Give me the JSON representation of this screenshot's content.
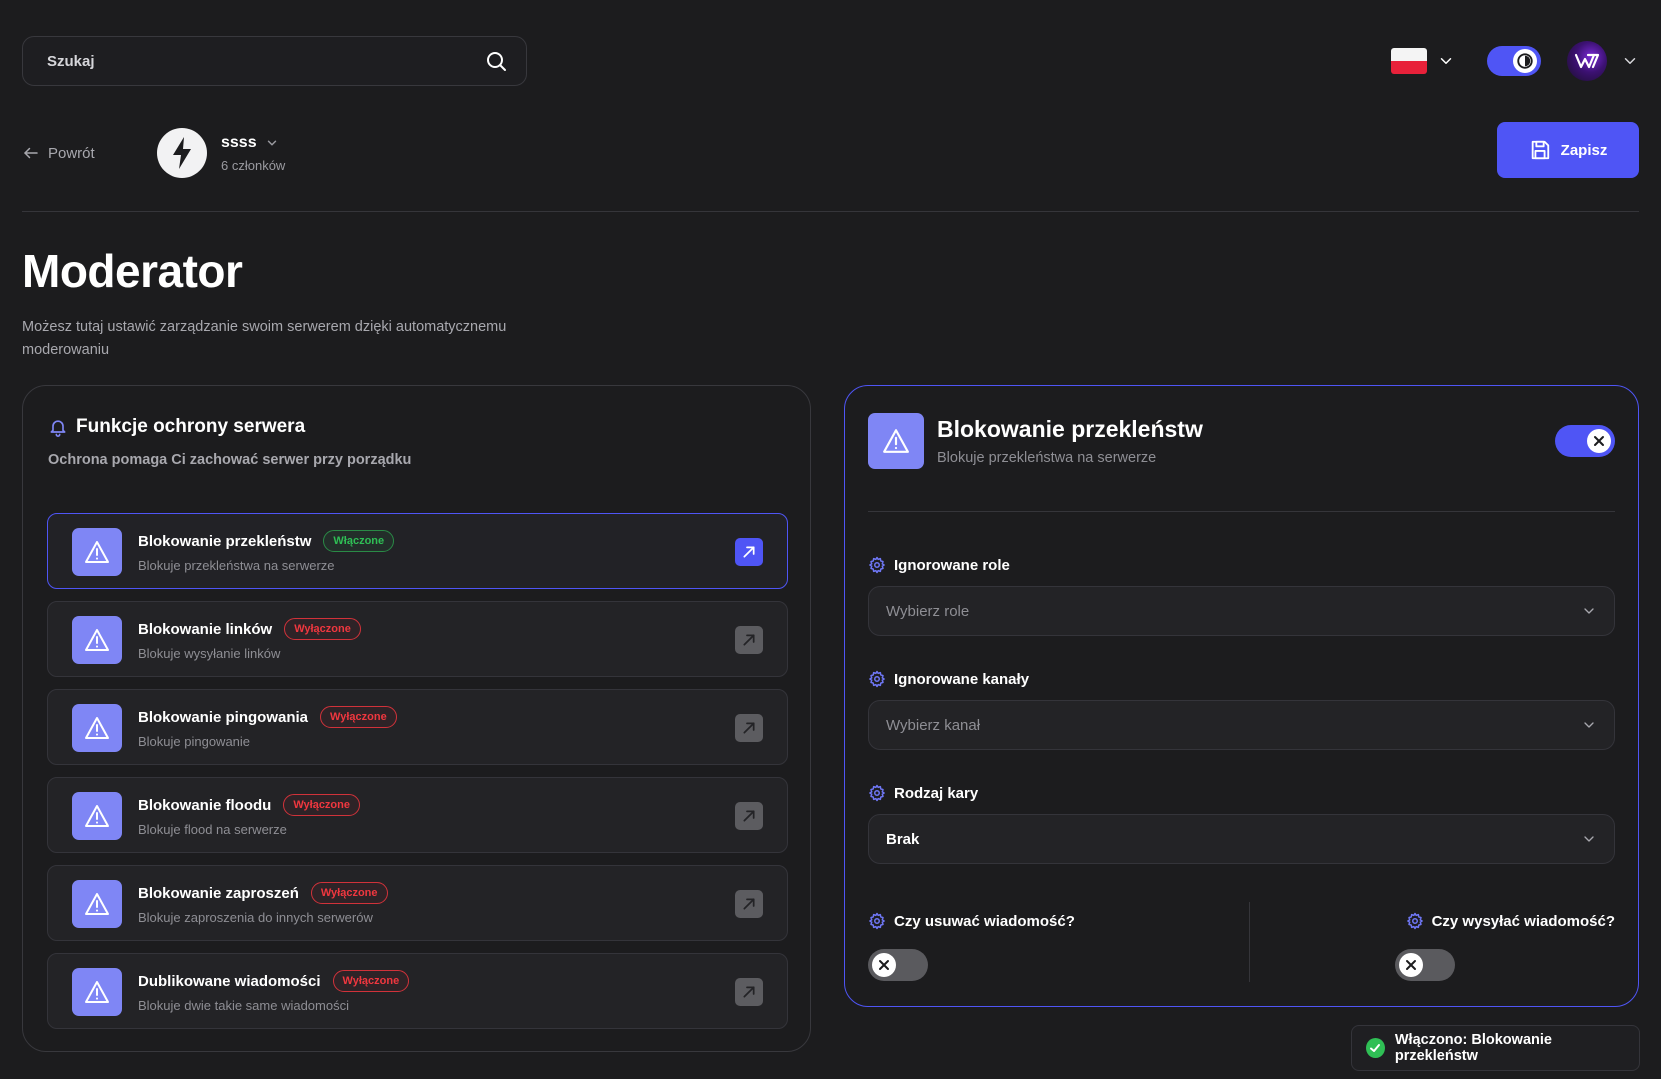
{
  "search": {
    "placeholder": "Szukaj"
  },
  "header": {
    "back_label": "Powrót",
    "server_name": "ssss",
    "server_members": "6 członków",
    "save_label": "Zapisz"
  },
  "page": {
    "title": "Moderator",
    "description": "Możesz tutaj ustawić zarządzanie swoim serwerem dzięki automatycznemu moderowaniu"
  },
  "protection": {
    "title": "Funkcje ochrony serwera",
    "subtitle": "Ochrona pomaga Ci zachować serwer przy porządku",
    "features": [
      {
        "name": "Blokowanie przekleństw",
        "status": "Włączone",
        "enabled": true,
        "desc": "Blokuje przekleństwa na serwerze"
      },
      {
        "name": "Blokowanie linków",
        "status": "Wyłączone",
        "enabled": false,
        "desc": "Blokuje wysyłanie linków"
      },
      {
        "name": "Blokowanie pingowania",
        "status": "Wyłączone",
        "enabled": false,
        "desc": "Blokuje pingowanie"
      },
      {
        "name": "Blokowanie floodu",
        "status": "Wyłączone",
        "enabled": false,
        "desc": "Blokuje flood na serwerze"
      },
      {
        "name": "Blokowanie zaproszeń",
        "status": "Wyłączone",
        "enabled": false,
        "desc": "Blokuje zaproszenia do innych serwerów"
      },
      {
        "name": "Dublikowane wiadomości",
        "status": "Wyłączone",
        "enabled": false,
        "desc": "Blokuje dwie takie same wiadomości"
      }
    ]
  },
  "detail": {
    "title": "Blokowanie przekleństw",
    "subtitle": "Blokuje przekleństwa na serwerze",
    "enabled": true,
    "ignored_roles_label": "Ignorowane role",
    "ignored_roles_placeholder": "Wybierz role",
    "ignored_channels_label": "Ignorowane kanały",
    "ignored_channels_placeholder": "Wybierz kanał",
    "punishment_label": "Rodzaj kary",
    "punishment_value": "Brak",
    "delete_msg_label": "Czy usuwać wiadomość?",
    "delete_msg_enabled": false,
    "send_msg_label": "Czy wysyłać wiadomość?",
    "send_msg_enabled": false
  },
  "toast": {
    "text": "Włączono: Blokowanie przekleństw"
  },
  "colors": {
    "accent": "#4f55f5",
    "icon_bg": "#7f86f5",
    "success": "#2fbf55",
    "danger": "#f0373f",
    "background": "#1c1c1e"
  },
  "icons": {
    "search": "search-icon",
    "flag": "poland-flag-icon",
    "theme": "theme-toggle-icon",
    "back": "arrow-left-icon",
    "server": "lightning-icon",
    "save": "floppy-disk-icon",
    "section": "bell-icon",
    "feature": "warning-triangle-icon",
    "open": "arrow-up-right-icon",
    "setting": "gear-icon",
    "toast": "check-circle-icon"
  }
}
